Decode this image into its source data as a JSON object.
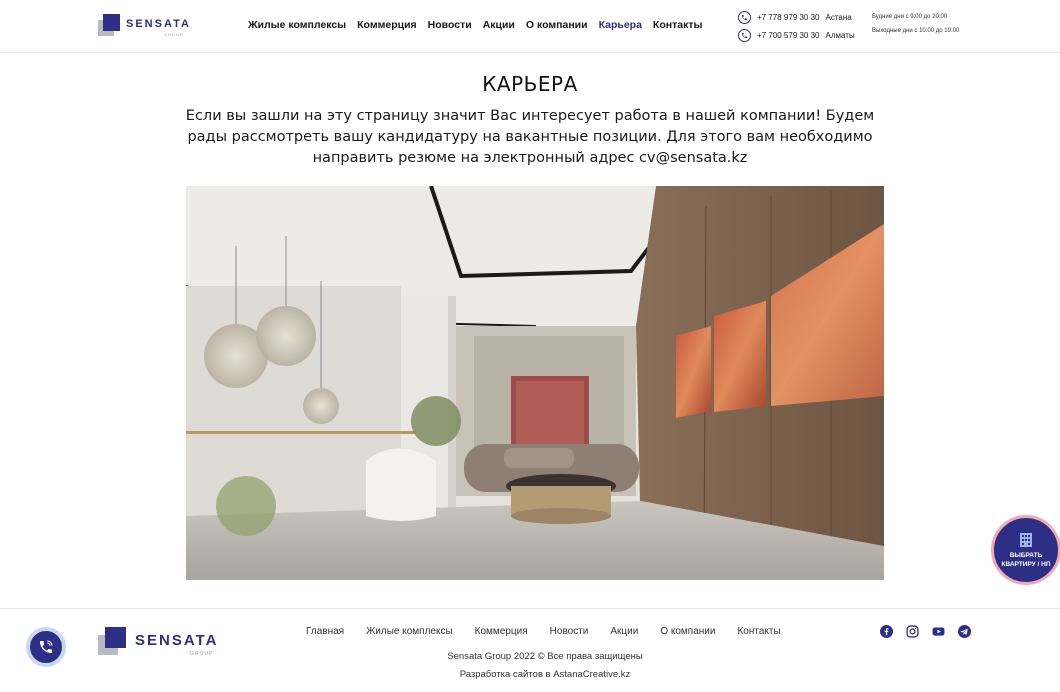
{
  "brand": {
    "name": "SENSATA",
    "sub": "GROUP",
    "primary_color": "#2d2f86",
    "gray_color": "#b7bac2"
  },
  "nav": {
    "items": [
      {
        "label": "Жилые комплексы",
        "active": false
      },
      {
        "label": "Коммерция",
        "active": false
      },
      {
        "label": "Новости",
        "active": false
      },
      {
        "label": "Акции",
        "active": false
      },
      {
        "label": "О компании",
        "active": false
      },
      {
        "label": "Карьера",
        "active": true
      },
      {
        "label": "Контакты",
        "active": false
      }
    ]
  },
  "contacts": {
    "phones": [
      {
        "number": "+7 778 979 30 30",
        "city": "Астана"
      },
      {
        "number": "+7 700 579 30 30",
        "city": "Алматы"
      }
    ],
    "hours": [
      "Будние дни с 9:00 до 20:00",
      "Выходные дни с 10:00 до 19:00"
    ]
  },
  "main": {
    "title": "КАРЬЕРА",
    "intro": "Если вы зашли на эту страницу значит Вас интересует работа в нашей компании! Будем рады рассмотреть вашу кандидатуру на вакантные позиции. Для этого вам необходимо направить резюме на электронный адрес cv@sensata.kz"
  },
  "cta": {
    "label_line1": "ВЫБРАТЬ",
    "label_line2": "КВАРТИРУ / НП",
    "ring_color": "#f3a9b4"
  },
  "footer": {
    "nav": [
      "Главная",
      "Жилые комплексы",
      "Коммерция",
      "Новости",
      "Акции",
      "О компании",
      "Контакты"
    ],
    "copyright": "Sensata Group 2022 © Все права защищены",
    "developer": "Разработка сайтов в AstanaCreative.kz",
    "socials": [
      "facebook-icon",
      "instagram-icon",
      "youtube-icon",
      "telegram-icon"
    ]
  }
}
